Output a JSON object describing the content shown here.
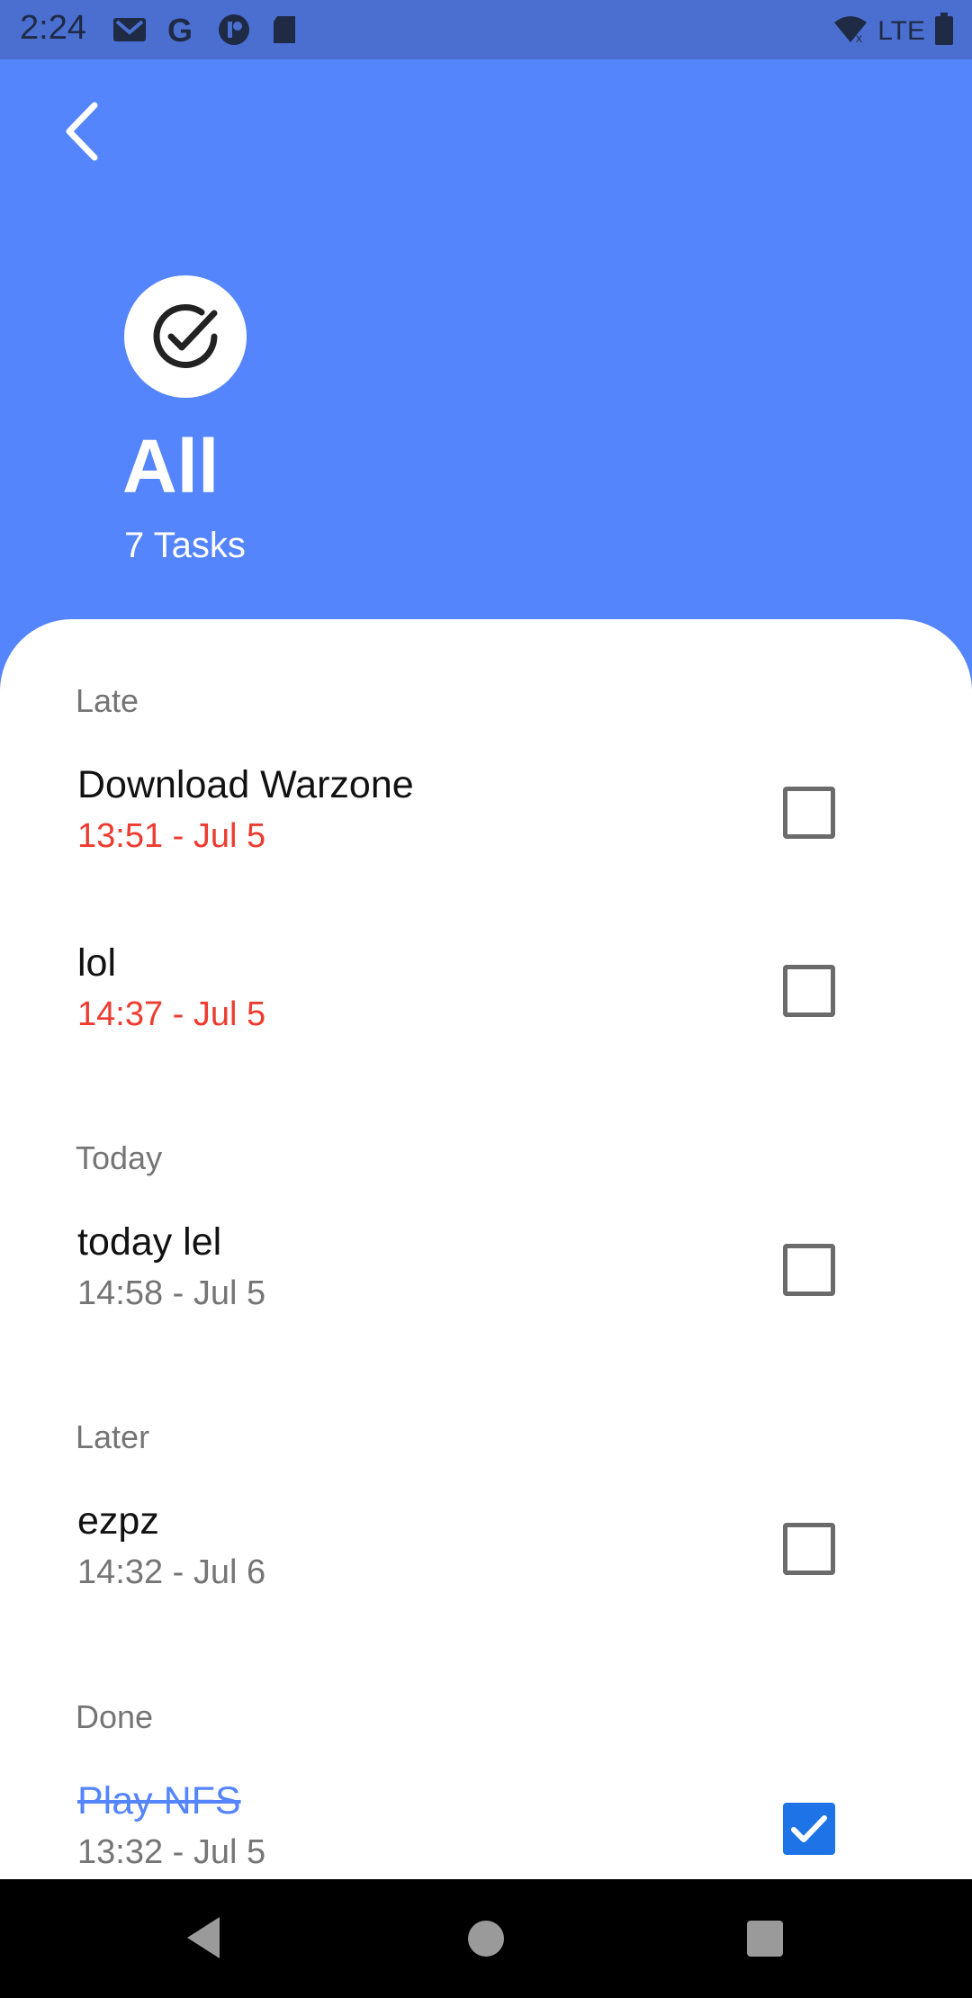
{
  "status_bar": {
    "time": "2:24",
    "network": "LTE"
  },
  "header": {
    "title": "All",
    "task_count": "7 Tasks"
  },
  "sections": [
    {
      "label": "Late",
      "tasks": [
        {
          "title": "Download Warzone",
          "time": "13:51 - Jul 5",
          "checked": false
        },
        {
          "title": "lol",
          "time": "14:37 - Jul 5",
          "checked": false
        }
      ]
    },
    {
      "label": "Today",
      "tasks": [
        {
          "title": "today lel",
          "time": "14:58 - Jul 5",
          "checked": false
        }
      ]
    },
    {
      "label": "Later",
      "tasks": [
        {
          "title": "ezpz",
          "time": "14:32 - Jul 6",
          "checked": false
        }
      ]
    },
    {
      "label": "Done",
      "tasks": [
        {
          "title": "Play NFS",
          "time": "13:32 - Jul 5",
          "checked": true
        }
      ]
    }
  ],
  "colors": {
    "primary": "#5585fc",
    "status_bar": "#4a6fd1",
    "late": "#ee3b2f",
    "checkbox_checked": "#1e74e6"
  }
}
